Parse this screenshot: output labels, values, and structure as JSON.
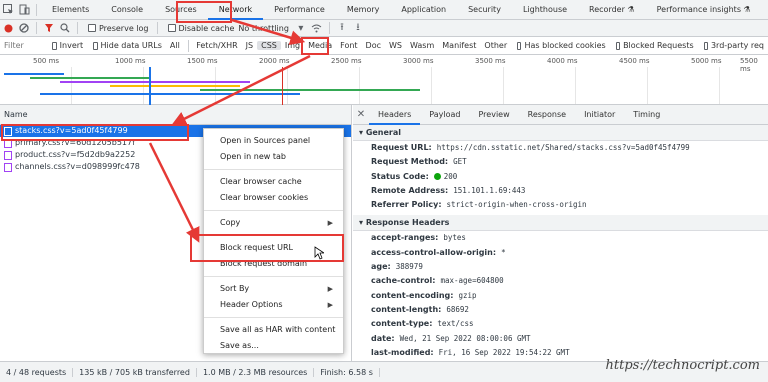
{
  "tabs": [
    "Elements",
    "Console",
    "Sources",
    "Network",
    "Performance",
    "Memory",
    "Application",
    "Security",
    "Lighthouse",
    "Recorder",
    "Performance insights"
  ],
  "toolbar": {
    "preserve_log": "Preserve log",
    "disable_cache": "Disable cache",
    "throttling": "No throttling"
  },
  "filterbar": {
    "placeholder": "Filter",
    "invert": "Invert",
    "hide_data_urls": "Hide data URLs",
    "types": [
      "All",
      "Fetch/XHR",
      "JS",
      "CSS",
      "Img",
      "Media",
      "Font",
      "Doc",
      "WS",
      "Wasm",
      "Manifest",
      "Other"
    ],
    "has_blocked_cookies": "Has blocked cookies",
    "blocked_requests": "Blocked Requests",
    "third_party": "3rd-party req"
  },
  "overview": {
    "ticks": [
      "500 ms",
      "1000 ms",
      "1500 ms",
      "2000 ms",
      "2500 ms",
      "3000 ms",
      "3500 ms",
      "4000 ms",
      "4500 ms",
      "5000 ms",
      "5500 ms"
    ]
  },
  "requests": {
    "header": "Name",
    "rows": [
      "stacks.css?v=5ad0f45f4799",
      "primary.css?v=60d1205b517f",
      "product.css?v=f5d2db9a2252",
      "channels.css?v=d098999fc478"
    ]
  },
  "details": {
    "tabs": [
      "Headers",
      "Payload",
      "Preview",
      "Response",
      "Initiator",
      "Timing"
    ],
    "general_title": "General",
    "general": [
      {
        "key": "Request URL:",
        "value": "https://cdn.sstatic.net/Shared/stacks.css?v=5ad0f45f4799"
      },
      {
        "key": "Request Method:",
        "value": "GET"
      },
      {
        "key": "Status Code:",
        "value": "200"
      },
      {
        "key": "Remote Address:",
        "value": "151.101.1.69:443"
      },
      {
        "key": "Referrer Policy:",
        "value": "strict-origin-when-cross-origin"
      }
    ],
    "response_title": "Response Headers",
    "response": [
      {
        "key": "accept-ranges:",
        "value": "bytes"
      },
      {
        "key": "access-control-allow-origin:",
        "value": "*"
      },
      {
        "key": "age:",
        "value": "388979"
      },
      {
        "key": "cache-control:",
        "value": "max-age=604800"
      },
      {
        "key": "content-encoding:",
        "value": "gzip"
      },
      {
        "key": "content-length:",
        "value": "68692"
      },
      {
        "key": "content-type:",
        "value": "text/css"
      },
      {
        "key": "date:",
        "value": "Wed, 21 Sep 2022 08:00:06 GMT"
      },
      {
        "key": "last-modified:",
        "value": "Fri, 16 Sep 2022 19:54:22 GMT"
      }
    ]
  },
  "context_menu": {
    "items": [
      "Open in Sources panel",
      "Open in new tab",
      "Clear browser cache",
      "Clear browser cookies",
      "Copy",
      "Block request URL",
      "Block request domain",
      "Sort By",
      "Header Options",
      "Save all as HAR with content",
      "Save as..."
    ]
  },
  "status": {
    "requests": "4 / 48 requests",
    "transferred": "135 kB / 705 kB transferred",
    "resources": "1.0 MB / 2.3 MB resources",
    "finish": "Finish: 6.58 s"
  },
  "watermark": "https://technocript.com",
  "colors": {
    "accent": "#1a73e8",
    "highlight": "#e53935",
    "record": "#d93025",
    "status_ok": "#0ca40c"
  }
}
